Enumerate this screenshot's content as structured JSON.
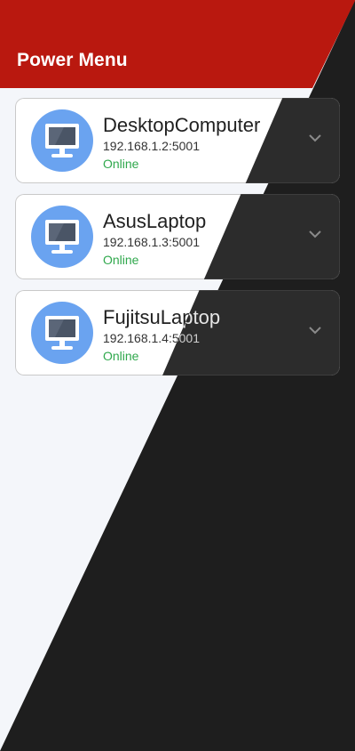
{
  "appbar": {
    "title": "Power Menu"
  },
  "devices": [
    {
      "name": "DesktopComputer",
      "address": "192.168.1.2:5001",
      "status": "Online",
      "icon": "monitor-icon"
    },
    {
      "name": "AsusLaptop",
      "address": "192.168.1.3:5001",
      "status": "Online",
      "icon": "monitor-icon"
    },
    {
      "name": "FujitsuLaptop",
      "address": "192.168.1.4:5001",
      "status": "Online",
      "icon": "monitor-icon"
    }
  ],
  "colors": {
    "appbar": "#b9180f",
    "avatar": "#6aa3f0",
    "online": "#2fa84c",
    "light_bg": "#f4f6fa",
    "dark_bg": "#1e1e1e"
  }
}
